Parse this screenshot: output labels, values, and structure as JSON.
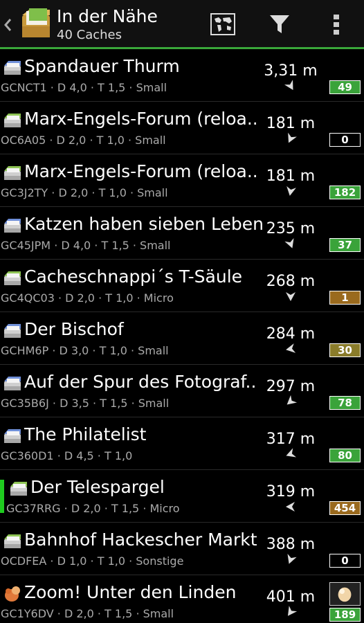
{
  "actionbar": {
    "title": "In der Nähe",
    "subtitle": "40 Caches",
    "icons": [
      "back-chevron-icon",
      "cache-box-icon",
      "map-icon",
      "filter-icon",
      "overflow-menu-icon"
    ]
  },
  "colors": {
    "accent": "#3aa83a",
    "selection": "#1fcb1f",
    "badge_green": "#3aa33a",
    "badge_brown": "#9a6a1e",
    "badge_olive": "#8a7c2a"
  },
  "caches": [
    {
      "name": "Spandauer Thurm",
      "info": "GCNCT1 · D 4,0 · T 1,5 · Small",
      "distance": "3,31 m",
      "count": "49",
      "badge": "green",
      "icon": "multi-cache-icon"
    },
    {
      "name": "Marx-Engels-Forum (reloa..",
      "info": "OC6A05 · D 2,0 · T 1,0 · Small",
      "distance": "181 m",
      "count": "0",
      "badge": "black",
      "icon": "traditional-cache-icon"
    },
    {
      "name": "Marx-Engels-Forum (reloa..",
      "info": "GC3J2TY · D 2,0 · T 1,0 · Small",
      "distance": "181 m",
      "count": "182",
      "badge": "green",
      "icon": "traditional-cache-icon"
    },
    {
      "name": "Katzen haben sieben Leben",
      "info": "GC45JPM · D 4,0 · T 1,5 · Small",
      "distance": "235 m",
      "count": "37",
      "badge": "green",
      "icon": "multi-cache-icon"
    },
    {
      "name": "Cacheschnappi´s T-Säule",
      "info": "GC4QC03 · D 2,0 · T 1,0 · Micro",
      "distance": "268 m",
      "count": "1",
      "badge": "brown",
      "icon": "traditional-cache-icon"
    },
    {
      "name": "Der Bischof",
      "info": "GCHM6P · D 3,0 · T 1,0 · Small",
      "distance": "284 m",
      "count": "30",
      "badge": "olive",
      "icon": "multi-cache-icon"
    },
    {
      "name": "Auf der Spur des Fotograf..",
      "info": "GC35B6J · D 3,5 · T 1,5 · Small",
      "distance": "297 m",
      "count": "78",
      "badge": "green",
      "icon": "multi-cache-icon"
    },
    {
      "name": "The Philatelist",
      "info": "GC360D1 · D 4,5 · T 1,0",
      "distance": "317 m",
      "count": "80",
      "badge": "green",
      "icon": "multi-cache-icon"
    },
    {
      "name": "Der Telespargel",
      "info": "GC37RRG · D 2,0 · T 1,5 · Micro",
      "distance": "319 m",
      "count": "454",
      "badge": "brown",
      "icon": "traditional-cache-icon",
      "selected": true
    },
    {
      "name": "Bahnhof Hackescher Markt",
      "info": "OCDFEA · D 1,0 · T 1,0 · Sonstige",
      "distance": "388 m",
      "count": "0",
      "badge": "black",
      "icon": "traditional-cache-icon"
    },
    {
      "name": "Zoom! Unter den Linden",
      "info": "GC1Y6DV · D 2,0 · T 1,5 · Small",
      "distance": "401 m",
      "count": "189",
      "badge": "green",
      "icon": "earth-cache-icon",
      "thumbnail": "cache-photo-thumbnail"
    }
  ]
}
